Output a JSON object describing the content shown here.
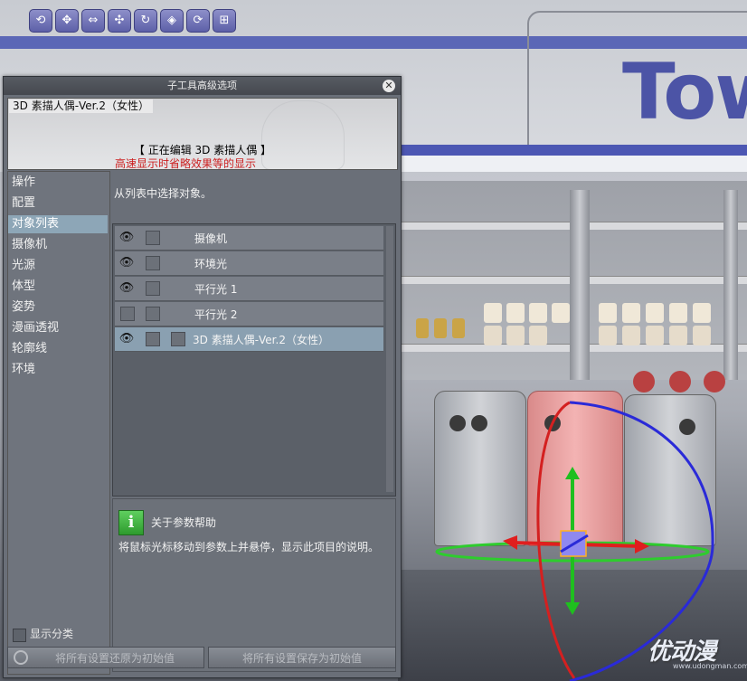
{
  "toolbar": {
    "icons": [
      "camera-rotate-icon",
      "camera-move-icon",
      "camera-zoom-icon",
      "object-move-icon",
      "object-rotate-icon",
      "object-move-plane-icon",
      "object-rotate-plane-icon",
      "object-scale-icon"
    ]
  },
  "scene": {
    "sign_text": "Tow"
  },
  "dialog": {
    "title": "子工具高级选项",
    "preview": {
      "title": "3D 素描人偶-Ver.2（女性）",
      "editing": "【 正在编辑 3D 素描人偶 】",
      "note": "高速显示时省略效果等的显示"
    },
    "nav": {
      "items": [
        {
          "label": "操作",
          "active": false
        },
        {
          "label": "配置",
          "active": false
        },
        {
          "label": "对象列表",
          "active": true
        },
        {
          "label": "摄像机",
          "active": false
        },
        {
          "label": "光源",
          "active": false
        },
        {
          "label": "体型",
          "active": false
        },
        {
          "label": "姿势",
          "active": false
        },
        {
          "label": "漫画透视",
          "active": false
        },
        {
          "label": "轮廓线",
          "active": false
        },
        {
          "label": "环境",
          "active": false
        }
      ],
      "show_category": "显示分类"
    },
    "content": {
      "hint": "从列表中选择对象。",
      "rows": [
        {
          "label": "摄像机",
          "visible": true,
          "selected": false
        },
        {
          "label": "环境光",
          "visible": true,
          "selected": false
        },
        {
          "label": "平行光 1",
          "visible": true,
          "selected": false
        },
        {
          "label": "平行光 2",
          "visible": false,
          "selected": false
        },
        {
          "label": "3D 素描人偶-Ver.2（女性）",
          "visible": true,
          "selected": true
        }
      ],
      "help": {
        "title": "关于参数帮助",
        "description": "将鼠标光标移动到参数上并悬停，显示此项目的说明。"
      }
    },
    "buttons": {
      "reset": "将所有设置还原为初始值",
      "save": "将所有设置保存为初始值"
    }
  },
  "watermark": {
    "brand": "优动漫",
    "url": "www.udongman.com"
  },
  "colors": {
    "accent": "#8da6b7",
    "selected_row": "#8aa0b1",
    "help_icon": "#3fae3f",
    "note_red": "#cc1f1f"
  }
}
